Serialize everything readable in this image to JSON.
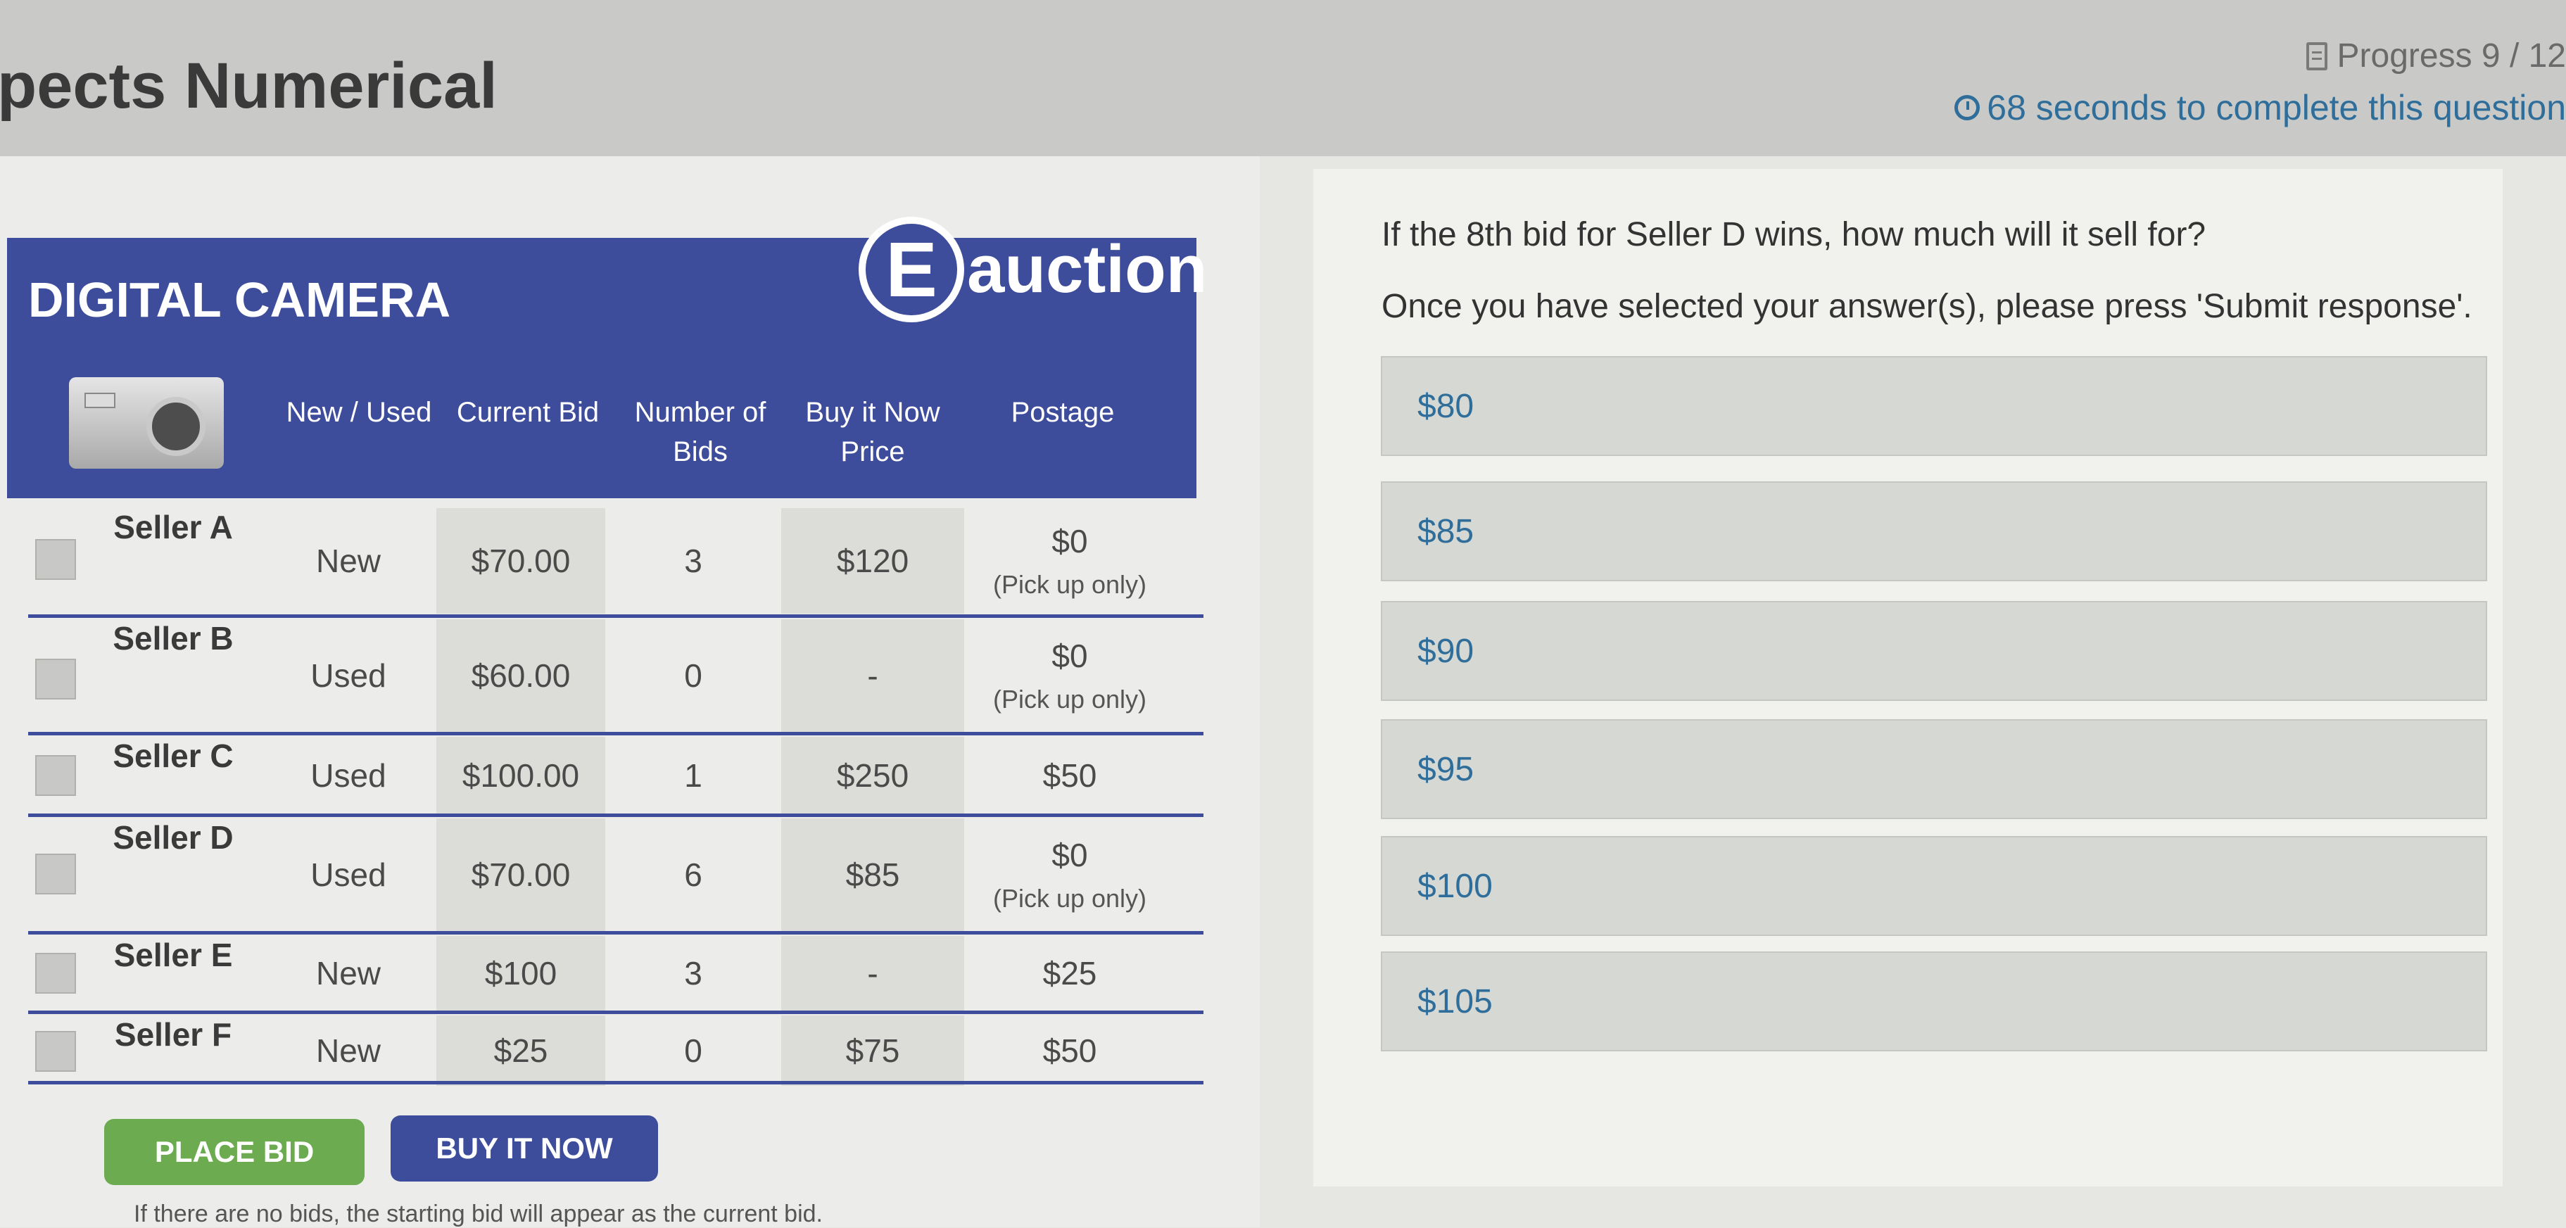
{
  "header": {
    "title": "pects Numerical",
    "progress_text": "Progress 9 / 12",
    "timer_text": "68 seconds to complete this question"
  },
  "auction": {
    "product_name": "DIGITAL CAMERA",
    "logo_letter": "E",
    "logo_text": "auction",
    "columns": {
      "condition": "New / Used",
      "current_bid": "Current Bid",
      "num_bids": "Number of Bids",
      "buy_now": "Buy it Now Price",
      "postage": "Postage"
    },
    "rows": [
      {
        "seller": "Seller A",
        "condition": "New",
        "current_bid": "$70.00",
        "num_bids": "3",
        "buy_now": "$120",
        "postage": "$0",
        "postage_note": "(Pick up only)"
      },
      {
        "seller": "Seller B",
        "condition": "Used",
        "current_bid": "$60.00",
        "num_bids": "0",
        "buy_now": "-",
        "postage": "$0",
        "postage_note": "(Pick up only)"
      },
      {
        "seller": "Seller C",
        "condition": "Used",
        "current_bid": "$100.00",
        "num_bids": "1",
        "buy_now": "$250",
        "postage": "$50",
        "postage_note": ""
      },
      {
        "seller": "Seller D",
        "condition": "Used",
        "current_bid": "$70.00",
        "num_bids": "6",
        "buy_now": "$85",
        "postage": "$0",
        "postage_note": "(Pick up only)"
      },
      {
        "seller": "Seller E",
        "condition": "New",
        "current_bid": "$100",
        "num_bids": "3",
        "buy_now": "-",
        "postage": "$25",
        "postage_note": ""
      },
      {
        "seller": "Seller F",
        "condition": "New",
        "current_bid": "$25",
        "num_bids": "0",
        "buy_now": "$75",
        "postage": "$50",
        "postage_note": ""
      }
    ],
    "place_bid_label": "PLACE BID",
    "buy_now_label": "BUY IT NOW",
    "footnote": "If there are no bids, the starting bid will appear as the current bid."
  },
  "question": {
    "prompt": "If the 8th bid for Seller D wins, how much will it sell for?",
    "instruction": "Once you have selected your answer(s), please press 'Submit response'.",
    "options": [
      "$80",
      "$85",
      "$90",
      "$95",
      "$100",
      "$105"
    ]
  },
  "colors": {
    "auction_blue": "#3d4d9b",
    "place_bid_green": "#6cab4f",
    "option_text": "#2f6e9a"
  }
}
